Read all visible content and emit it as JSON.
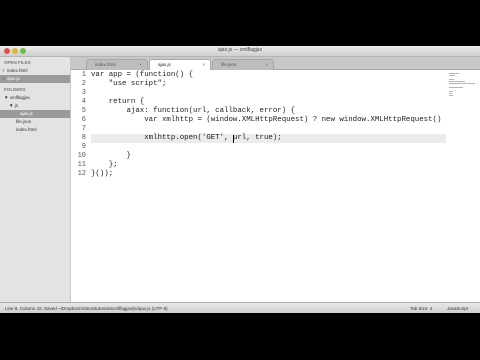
{
  "window": {
    "title": "ajax.js — xmlflagjax"
  },
  "sidebar": {
    "open_files_header": "OPEN FILES",
    "open_files": [
      {
        "label": "index.html"
      },
      {
        "label": "ajax.js"
      }
    ],
    "folders_header": "FOLDERS",
    "folders": [
      {
        "label": "▼ xmlflagjax"
      },
      {
        "label": "▼ js"
      },
      {
        "label": "ajax.js"
      },
      {
        "label": "file.json"
      },
      {
        "label": "index.html"
      }
    ]
  },
  "tabs": [
    {
      "label": "index.html",
      "close": "×"
    },
    {
      "label": "ajax.js",
      "close": "×"
    },
    {
      "label": "file.json",
      "close": "×"
    }
  ],
  "editor": {
    "line_numbers": [
      "1",
      "2",
      "3",
      "4",
      "5",
      "6",
      "7",
      "8",
      "9",
      "10",
      "11",
      "12"
    ],
    "lines": [
      "var app = (function() {",
      "    \"use script\";",
      "",
      "    return {",
      "        ajax: function(url, callback, error) {",
      "            var xmlhttp = (window.XMLHttpRequest) ? new window.XMLHttpRequest() : ne",
      "",
      "            xmlhttp.open('GET', url, true);",
      "",
      "        }",
      "    };",
      "}());"
    ]
  },
  "status": {
    "left": "Line 8, Column 42; Saved ~/Dropbox/Videos/tutorials/xmlflagjax/js/ajax.js (UTF-8)",
    "tab_size": "Tab Size: 4",
    "syntax": "JavaScript"
  }
}
